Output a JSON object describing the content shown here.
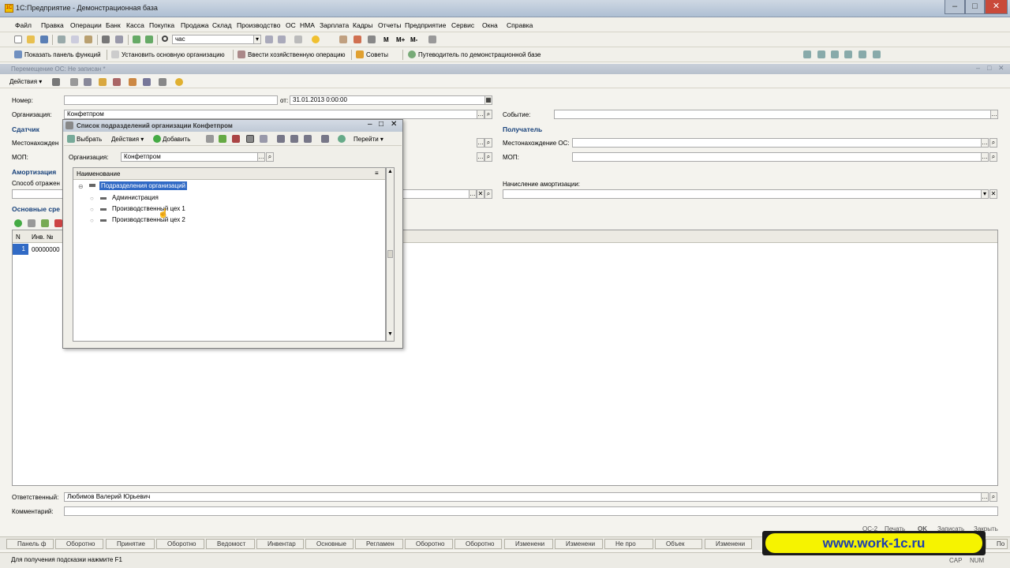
{
  "window": {
    "title": "1С:Предприятие - Демонстрационная база"
  },
  "menu": [
    "Файл",
    "Правка",
    "Операции",
    "Банк",
    "Касса",
    "Покупка",
    "Продажа",
    "Склад",
    "Производство",
    "ОС",
    "НМА",
    "Зарплата",
    "Кадры",
    "Отчеты",
    "Предприятие",
    "Сервис",
    "Окна",
    "Справка"
  ],
  "toolbar1": {
    "search_value": "час"
  },
  "toolbar2": {
    "show_panel": "Показать панель функций",
    "set_org": "Установить основную организацию",
    "enter_op": "Ввести хозяйственную операцию",
    "tips": "Советы",
    "guide": "Путеводитель по демонстрационной базе"
  },
  "doc": {
    "title": "Перемещение ОС: Не записан *",
    "actions": "Действия",
    "number_label": "Номер:",
    "number_value": "",
    "date_label": "от:",
    "date_value": "31.01.2013  0:00:00",
    "org_label": "Организация:",
    "org_value": "Конфетпром",
    "event_label": "Событие:",
    "event_value": "",
    "sender_section": "Сдатчик",
    "receiver_section": "Получатель",
    "loc_label_left": "Местонахожден",
    "loc_label_right": "Местонахождение ОС:",
    "mop_label": "МОП:",
    "amort_section": "Амортизация",
    "method_label": "Способ отражен",
    "accrual_label": "Начисление амортизации:",
    "assets_section": "Основные сре",
    "table_col_n": "N",
    "table_col_inv": "Инв. №",
    "row_n": "1",
    "row_inv": "00000000",
    "resp_label": "Ответственный:",
    "resp_value": "Любимов Валерий Юрьевич",
    "comment_label": "Комментарий:",
    "comment_value": ""
  },
  "popup": {
    "title": "Список подразделений организации Конфетпром",
    "select_btn": "Выбрать",
    "actions_btn": "Действия",
    "add_btn": "Добавить",
    "goto_btn": "Перейти",
    "org_label": "Организация:",
    "org_value": "Конфетпром",
    "column_header": "Наименование",
    "tree_root": "Подразделения организаций",
    "tree_items": [
      "Администрация",
      "Производственный цех 1",
      "Производственный цех 2"
    ]
  },
  "bottom_buttons": {
    "os2": "ОС-2",
    "print": "Печать",
    "ok": "OK",
    "write": "Записать",
    "close": "Закрыть"
  },
  "tabs": [
    "Панель ф",
    "Оборотно",
    "Принятие",
    "Оборотно",
    "Ведомост",
    "Инвентар",
    "Основные",
    "Регламен",
    "Оборотно",
    "Оборотно",
    "Изменени",
    "Изменени",
    "Не про",
    "Объек",
    "Изменени",
    "По"
  ],
  "status": {
    "hint": "Для получения подсказки нажмите F1",
    "cap": "CAP",
    "num": "NUM"
  },
  "banner": {
    "text": "www.work-1c.ru"
  },
  "colors": {
    "selection": "#316ac5",
    "section_text": "#16407a",
    "banner_bg": "#f6f300",
    "banner_text": "#1c3fb0"
  }
}
